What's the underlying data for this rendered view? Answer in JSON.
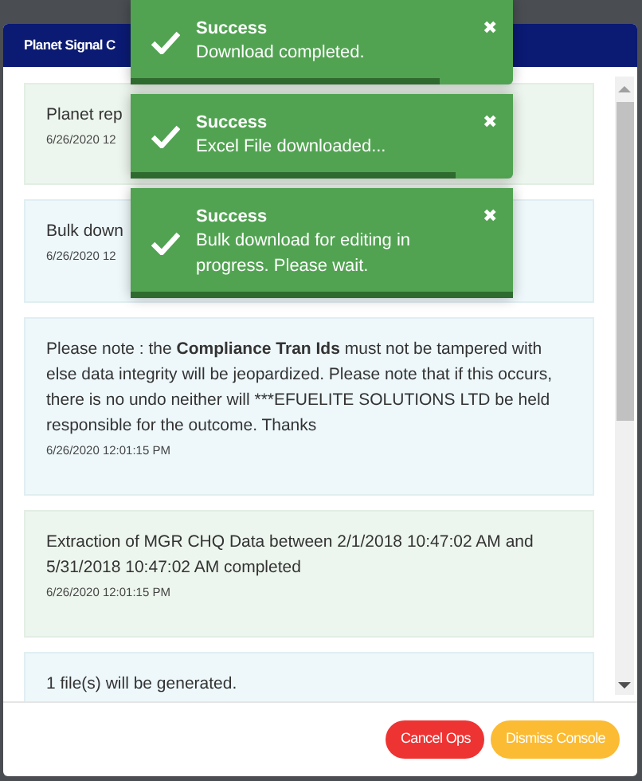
{
  "modal": {
    "title": "Planet Signal C"
  },
  "messages": [
    {
      "kind": "success",
      "text": "Planet rep",
      "time": "6/26/2020 12"
    },
    {
      "kind": "info",
      "text": "Bulk down",
      "time": "6/26/2020 12"
    },
    {
      "kind": "info",
      "text": "Please note : the **Compliance Tran Ids** must not be tampered with else data integrity will be jeopardized. Please note that if this occurs, there is no undo neither will ***EFUELITE SOLUTIONS LTD be held responsible for the outcome. Thanks",
      "time": "6/26/2020 12:01:15 PM"
    },
    {
      "kind": "success",
      "text": "Extraction of MGR CHQ Data between 2/1/2018 10:47:02 AM and 5/31/2018 10:47:02 AM completed",
      "time": "6/26/2020 12:01:15 PM"
    },
    {
      "kind": "info",
      "text": "1 file(s) will be generated."
    }
  ],
  "buttons": [
    {
      "label": "Cancel Ops",
      "kind": "danger"
    },
    {
      "label": "Dismiss Console",
      "kind": "warning"
    }
  ],
  "toasts": [
    {
      "title": "Success",
      "message": "Download completed.",
      "close": "✖",
      "level": 0.81
    },
    {
      "title": "Success",
      "message": "Excel File downloaded...",
      "close": "✖",
      "level": 0.85
    },
    {
      "title": "Success",
      "message": "Bulk download for editing in progress. Please wait.",
      "close": "✖",
      "level": 1
    }
  ]
}
